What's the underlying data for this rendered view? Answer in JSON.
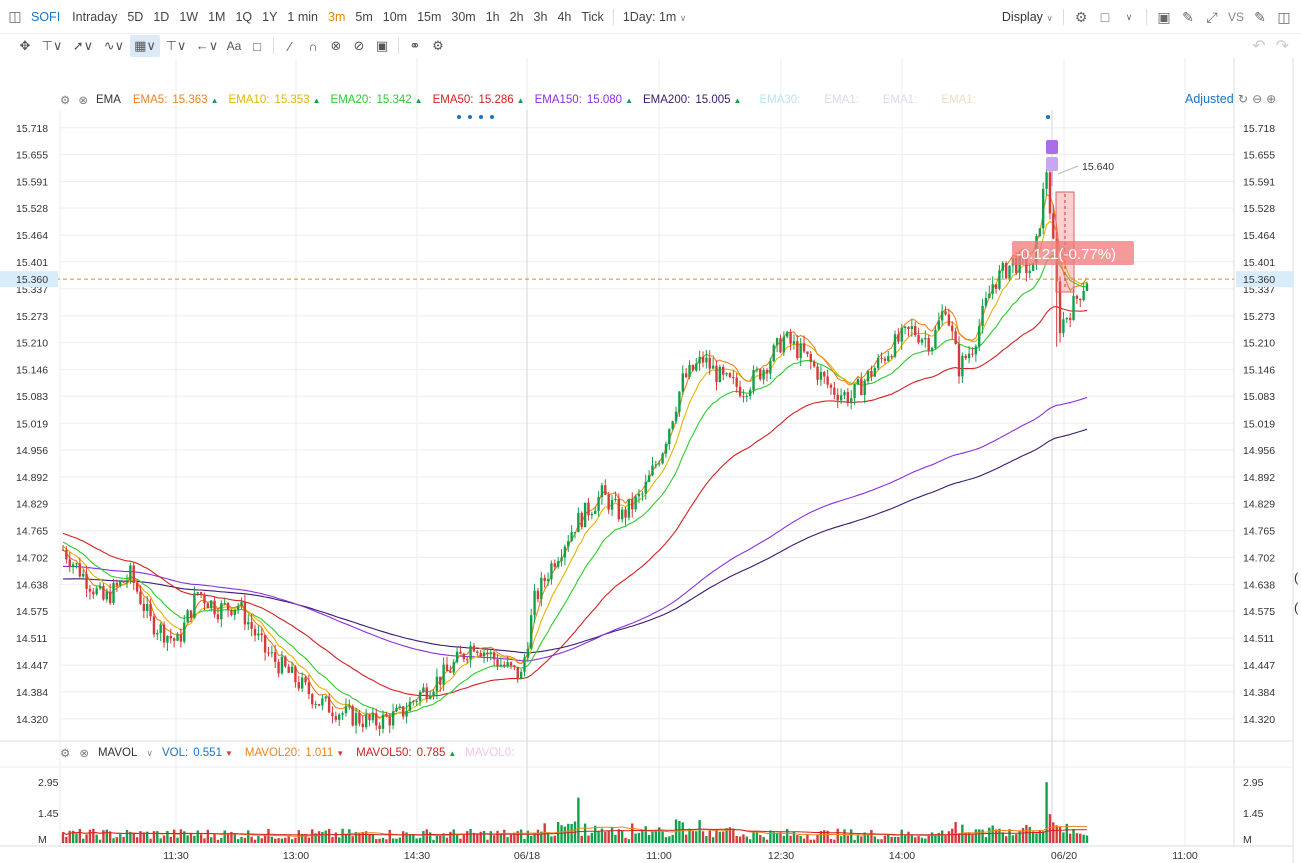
{
  "toolbar": {
    "symbol": "SOFI",
    "timeframes": [
      "Intraday",
      "5D",
      "1D",
      "1W",
      "1M",
      "1Q",
      "1Y",
      "1 min",
      "3m",
      "5m",
      "10m",
      "15m",
      "30m",
      "1h",
      "2h",
      "3h",
      "4h",
      "Tick"
    ],
    "active_timeframe": "3m",
    "interval_select": "1Day: 1m",
    "display_label": "Display",
    "vs_label": "VS"
  },
  "ema_legend": {
    "label": "EMA",
    "items": [
      {
        "name": "EMA5:",
        "value": "15.363",
        "color": "#f0821e"
      },
      {
        "name": "EMA10:",
        "value": "15.353",
        "color": "#e8b400"
      },
      {
        "name": "EMA20:",
        "value": "15.342",
        "color": "#2ecc2e"
      },
      {
        "name": "EMA50:",
        "value": "15.286",
        "color": "#d42020"
      },
      {
        "name": "EMA150:",
        "value": "15.080",
        "color": "#8a2ee0"
      },
      {
        "name": "EMA200:",
        "value": "15.005",
        "color": "#3b1a6e"
      }
    ],
    "faded": [
      "EMA30:",
      "EMA1:",
      "EMA1:",
      "EMA1:"
    ]
  },
  "adjusted_label": "Adjusted",
  "price_axis": {
    "ticks": [
      "15.718",
      "15.655",
      "15.591",
      "15.528",
      "15.464",
      "15.401",
      "15.337",
      "15.273",
      "15.210",
      "15.146",
      "15.083",
      "15.019",
      "14.956",
      "14.892",
      "14.829",
      "14.765",
      "14.702",
      "14.638",
      "14.575",
      "14.511",
      "14.447",
      "14.384",
      "14.320"
    ],
    "current": "15.360"
  },
  "annotations": {
    "high_label": "15.640",
    "change_label": "-0.121(-0.77%)"
  },
  "volume_legend": {
    "label": "MAVOL",
    "items": [
      {
        "name": "VOL:",
        "value": "0.551",
        "color": "#1a73c6"
      },
      {
        "name": "MAVOL20:",
        "value": "1.011",
        "color": "#f0821e"
      },
      {
        "name": "MAVOL50:",
        "value": "0.785",
        "color": "#d42020"
      }
    ],
    "faded": "MAVOL0:"
  },
  "volume_axis": [
    "2.95",
    "1.45",
    "M"
  ],
  "time_axis": [
    "11:30",
    "13:00",
    "14:30",
    "06/18",
    "11:00",
    "12:30",
    "14:00",
    "06/20",
    "11:00"
  ],
  "colors": {
    "up": "#13a04a",
    "down": "#d43b3b",
    "grid": "#eeeeee"
  },
  "chart_data": {
    "type": "candlestick",
    "y_range": [
      14.27,
      15.76
    ],
    "ema_endpoints": {
      "EMA5": 15.363,
      "EMA10": 15.353,
      "EMA20": 15.342,
      "EMA50": 15.286,
      "EMA150": 15.08,
      "EMA200": 15.005
    },
    "ema_start": {
      "EMA5": 14.72,
      "EMA10": 14.73,
      "EMA20": 14.74,
      "EMA50": 14.76,
      "EMA150": 14.68,
      "EMA200": 14.65
    },
    "price_path": [
      [
        0,
        14.72
      ],
      [
        12,
        14.6
      ],
      [
        20,
        14.66
      ],
      [
        26,
        14.55
      ],
      [
        34,
        14.5
      ],
      [
        40,
        14.62
      ],
      [
        46,
        14.58
      ],
      [
        52,
        14.59
      ],
      [
        60,
        14.48
      ],
      [
        68,
        14.42
      ],
      [
        76,
        14.36
      ],
      [
        84,
        14.33
      ],
      [
        92,
        14.31
      ],
      [
        100,
        14.33
      ],
      [
        106,
        14.38
      ],
      [
        114,
        14.43
      ],
      [
        122,
        14.5
      ],
      [
        130,
        14.45
      ],
      [
        136,
        14.42
      ],
      [
        140,
        14.6
      ],
      [
        146,
        14.7
      ],
      [
        152,
        14.78
      ],
      [
        160,
        14.85
      ],
      [
        166,
        14.8
      ],
      [
        172,
        14.85
      ],
      [
        178,
        14.96
      ],
      [
        184,
        15.12
      ],
      [
        190,
        15.17
      ],
      [
        196,
        15.12
      ],
      [
        202,
        15.1
      ],
      [
        208,
        15.15
      ],
      [
        214,
        15.22
      ],
      [
        220,
        15.18
      ],
      [
        228,
        15.1
      ],
      [
        234,
        15.08
      ],
      [
        240,
        15.14
      ],
      [
        246,
        15.2
      ],
      [
        252,
        15.24
      ],
      [
        258,
        15.21
      ],
      [
        262,
        15.3
      ],
      [
        266,
        15.15
      ],
      [
        270,
        15.2
      ],
      [
        276,
        15.35
      ],
      [
        282,
        15.4
      ],
      [
        288,
        15.38
      ],
      [
        292,
        15.62
      ],
      [
        296,
        15.25
      ],
      [
        300,
        15.3
      ],
      [
        304,
        15.36
      ]
    ],
    "volume_marks": [
      {
        "label": "06/18 spike",
        "value": 2.2
      },
      {
        "label": "06/20 spike",
        "value": 2.95
      }
    ],
    "volume_ylim": [
      0,
      3.2
    ]
  }
}
